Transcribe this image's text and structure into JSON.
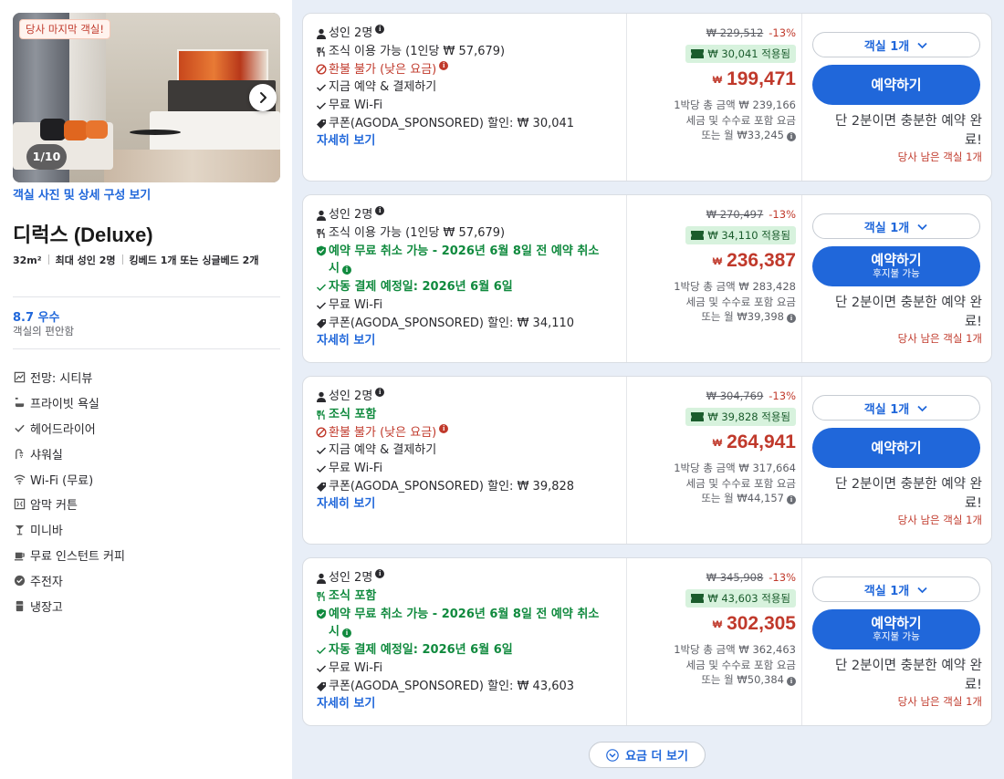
{
  "room": {
    "badge_last": "당사 마지막 객실!",
    "photo_counter": "1/10",
    "photo_link": "객실 사진 및 상세 구성 보기",
    "title": "디럭스 (Deluxe)",
    "size": "32m²",
    "max_guests": "최대 성인 2명",
    "beds": "킹베드 1개 또는 싱글베드 2개",
    "score": "8.7 우수",
    "score_sub": "객실의 편안함",
    "amenities": [
      {
        "icon": "view-icon",
        "label": "전망: 시티뷰"
      },
      {
        "icon": "bathtub-icon",
        "label": "프라이빗 욕실"
      },
      {
        "icon": "check-icon",
        "label": "헤어드라이어"
      },
      {
        "icon": "shower-icon",
        "label": "샤워실"
      },
      {
        "icon": "wifi-icon",
        "label": "Wi-Fi (무료)"
      },
      {
        "icon": "blackout-curtain-icon",
        "label": "암막 커튼"
      },
      {
        "icon": "minibar-icon",
        "label": "미니바"
      },
      {
        "icon": "coffee-icon",
        "label": "무료 인스턴트 커피"
      },
      {
        "icon": "kettle-icon",
        "label": "주전자"
      },
      {
        "icon": "fridge-icon",
        "label": "냉장고"
      }
    ]
  },
  "offers": [
    {
      "guests": "성인 2명",
      "meal": "조식 이용 가능 (1인당 ₩ 57,679)",
      "policy": "환불 불가 (낮은 요금)",
      "extra": "지금 예약 & 결제하기",
      "wifi": "무료 Wi-Fi",
      "coupon": "쿠폰(AGODA_SPONSORED) 할인: ₩ 30,041",
      "details": "자세히 보기",
      "original_price": "₩ 229,512",
      "discount": "-13%",
      "coupon_applied": "₩ 30,041 적용됨",
      "currency": "₩",
      "price": "199,471",
      "total_label": "1박당 총 금액 ₩ 239,166",
      "tax_label": "세금 및 수수료 포함 요금",
      "monthly": "또는 월 ₩33,245",
      "rooms_select": "객실 1개",
      "book_label": "예약하기",
      "book_sub": "",
      "quick_note": "단 2분이면 충분한 예약 완료!",
      "left_rooms": "당사 남은 객실 1개"
    },
    {
      "guests": "성인 2명",
      "meal": "조식 이용 가능 (1인당 ₩ 57,679)",
      "cancel": "예약 무료 취소 가능 - 2026년 6월 8일 전 예약 취소 시",
      "autopay": "자동 결제 예정일: 2026년 6월 6일",
      "wifi": "무료 Wi-Fi",
      "coupon": "쿠폰(AGODA_SPONSORED) 할인: ₩ 34,110",
      "details": "자세히 보기",
      "original_price": "₩ 270,497",
      "discount": "-13%",
      "coupon_applied": "₩ 34,110 적용됨",
      "currency": "₩",
      "price": "236,387",
      "total_label": "1박당 총 금액 ₩ 283,428",
      "tax_label": "세금 및 수수료 포함 요금",
      "monthly": "또는 월 ₩39,398",
      "rooms_select": "객실 1개",
      "book_label": "예약하기",
      "book_sub": "후지불 가능",
      "quick_note": "단 2분이면 충분한 예약 완료!",
      "left_rooms": "당사 남은 객실 1개"
    },
    {
      "guests": "성인 2명",
      "meal": "조식 포함",
      "policy": "환불 불가 (낮은 요금)",
      "extra": "지금 예약 & 결제하기",
      "wifi": "무료 Wi-Fi",
      "coupon": "쿠폰(AGODA_SPONSORED) 할인: ₩ 39,828",
      "details": "자세히 보기",
      "original_price": "₩ 304,769",
      "discount": "-13%",
      "coupon_applied": "₩ 39,828 적용됨",
      "currency": "₩",
      "price": "264,941",
      "total_label": "1박당 총 금액 ₩ 317,664",
      "tax_label": "세금 및 수수료 포함 요금",
      "monthly": "또는 월 ₩44,157",
      "rooms_select": "객실 1개",
      "book_label": "예약하기",
      "book_sub": "",
      "quick_note": "단 2분이면 충분한 예약 완료!",
      "left_rooms": "당사 남은 객실 1개"
    },
    {
      "guests": "성인 2명",
      "meal": "조식 포함",
      "cancel": "예약 무료 취소 가능 - 2026년 6월 8일 전 예약 취소 시",
      "autopay": "자동 결제 예정일: 2026년 6월 6일",
      "wifi": "무료 Wi-Fi",
      "coupon": "쿠폰(AGODA_SPONSORED) 할인: ₩ 43,603",
      "details": "자세히 보기",
      "original_price": "₩ 345,908",
      "discount": "-13%",
      "coupon_applied": "₩ 43,603 적용됨",
      "currency": "₩",
      "price": "302,305",
      "total_label": "1박당 총 금액 ₩ 362,463",
      "tax_label": "세금 및 수수료 포함 요금",
      "monthly": "또는 월 ₩50,384",
      "rooms_select": "객실 1개",
      "book_label": "예약하기",
      "book_sub": "후지불 가능",
      "quick_note": "단 2분이면 충분한 예약 완료!",
      "left_rooms": "당사 남은 객실 1개"
    }
  ],
  "more_rates": "요금 더 보기",
  "colors": {
    "accent": "#2067da",
    "price_red": "#c0392b",
    "green": "#108a3e",
    "coupon_bg": "#d7f2dd",
    "page_bg": "#e8eef7"
  }
}
